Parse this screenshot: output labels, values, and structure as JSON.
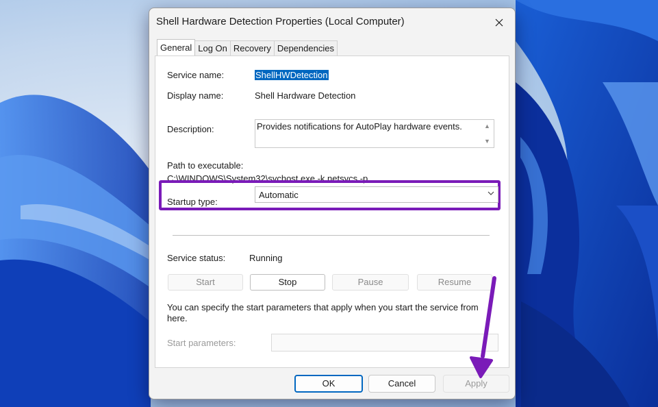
{
  "window": {
    "title": "Shell Hardware Detection Properties (Local Computer)"
  },
  "tabs": [
    {
      "label": "General",
      "active": true
    },
    {
      "label": "Log On",
      "active": false
    },
    {
      "label": "Recovery",
      "active": false
    },
    {
      "label": "Dependencies",
      "active": false
    }
  ],
  "general": {
    "service_name_label": "Service name:",
    "service_name_value": "ShellHWDetection",
    "display_name_label": "Display name:",
    "display_name_value": "Shell Hardware Detection",
    "description_label": "Description:",
    "description_value": "Provides notifications for AutoPlay hardware events.",
    "path_label": "Path to executable:",
    "path_value": "C:\\WINDOWS\\System32\\svchost.exe -k netsvcs -p",
    "startup_type_label": "Startup type:",
    "startup_type_value": "Automatic",
    "service_status_label": "Service status:",
    "service_status_value": "Running",
    "buttons": {
      "start": "Start",
      "stop": "Stop",
      "pause": "Pause",
      "resume": "Resume"
    },
    "hint_text_line1": "You can specify the start parameters that apply when you start the service from",
    "hint_text_line2": "here.",
    "start_parameters_label": "Start parameters:",
    "start_parameters_value": ""
  },
  "footer": {
    "ok": "OK",
    "cancel": "Cancel",
    "apply": "Apply"
  },
  "colors": {
    "highlight": "#7a1bb8",
    "selection": "#0067c0",
    "arrow": "#7a1bb8"
  }
}
